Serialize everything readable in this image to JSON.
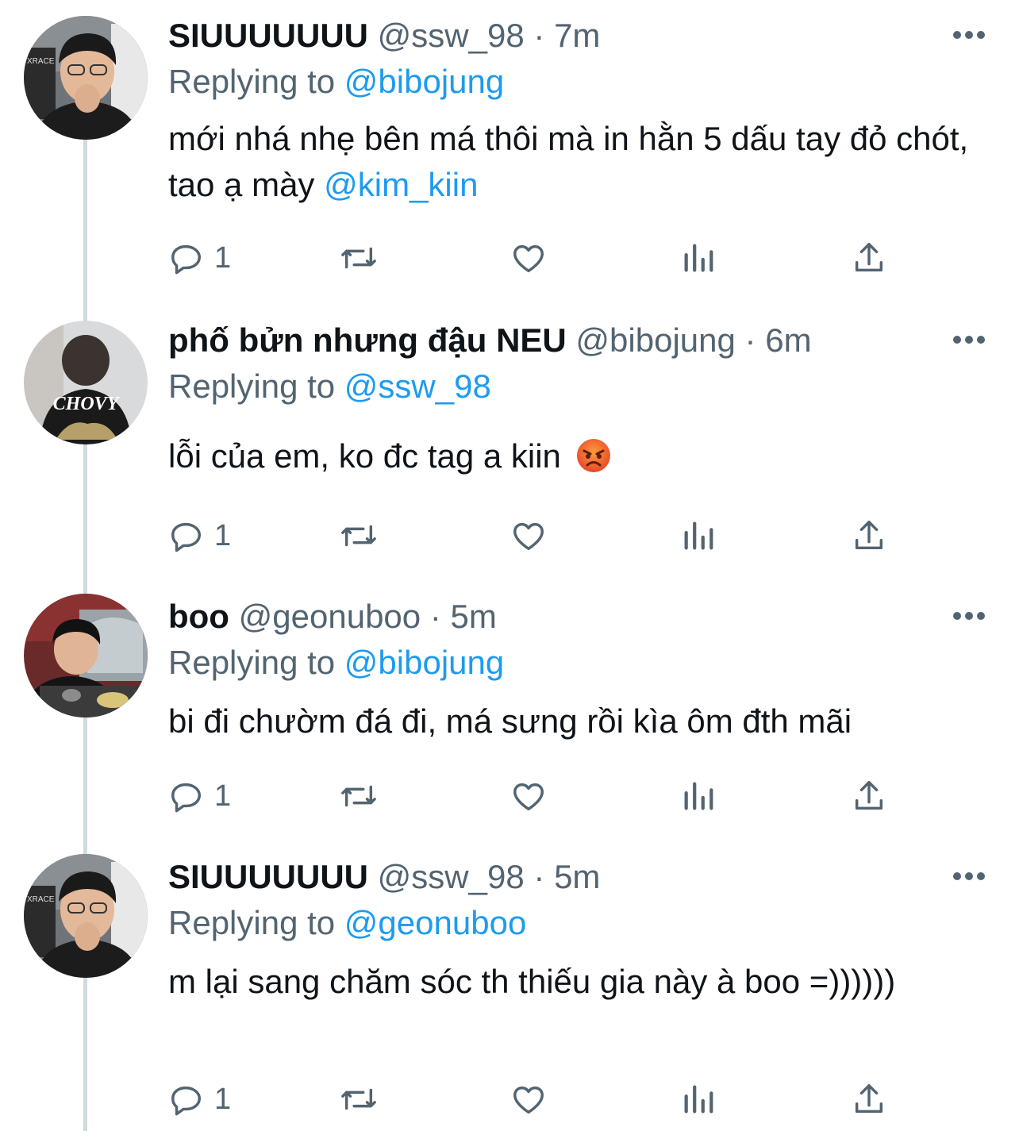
{
  "tweets": [
    {
      "name": "SIUUUUUUU",
      "handle": "@ssw_98",
      "sep": "·",
      "time": "7m",
      "replying_label": "Replying to",
      "replying_to": "@bibojung",
      "text": "mới nhá nhẹ bên má thôi mà in hằn 5 dấu tay đỏ chót, tao ạ mày",
      "text_mention": "@kim_kiin",
      "reply_count": "1",
      "avatar_icon": "profile-photo"
    },
    {
      "name": "phố bửn nhưng đậu NEU",
      "handle": "@bibojung",
      "sep": "·",
      "time": "6m",
      "replying_label": "Replying to",
      "replying_to": "@ssw_98",
      "text": "lỗi của em, ko đc tag a kiin",
      "emoji": "angry-face-emoji",
      "avatar_text": "CHOVY",
      "reply_count": "1"
    },
    {
      "name": "boo",
      "handle": "@geonuboo",
      "sep": "·",
      "time": "5m",
      "replying_label": "Replying to",
      "replying_to": "@bibojung",
      "text": "bi đi chườm đá đi, má sưng rồi kìa ôm đth mãi",
      "reply_count": "1"
    },
    {
      "name": "SIUUUUUUU",
      "handle": "@ssw_98",
      "sep": "·",
      "time": "5m",
      "replying_label": "Replying to",
      "replying_to": "@geonuboo",
      "text": "m lại sang chăm sóc th thiếu gia này à boo =))))))",
      "reply_count": "1"
    }
  ],
  "icons": [
    "reply-icon",
    "retweet-icon",
    "like-icon",
    "views-icon",
    "share-icon",
    "more-icon"
  ],
  "colors": {
    "link": "#1d9bf0",
    "secondary": "#536471",
    "text": "#0f1419",
    "thread_line": "#cfd9de"
  }
}
